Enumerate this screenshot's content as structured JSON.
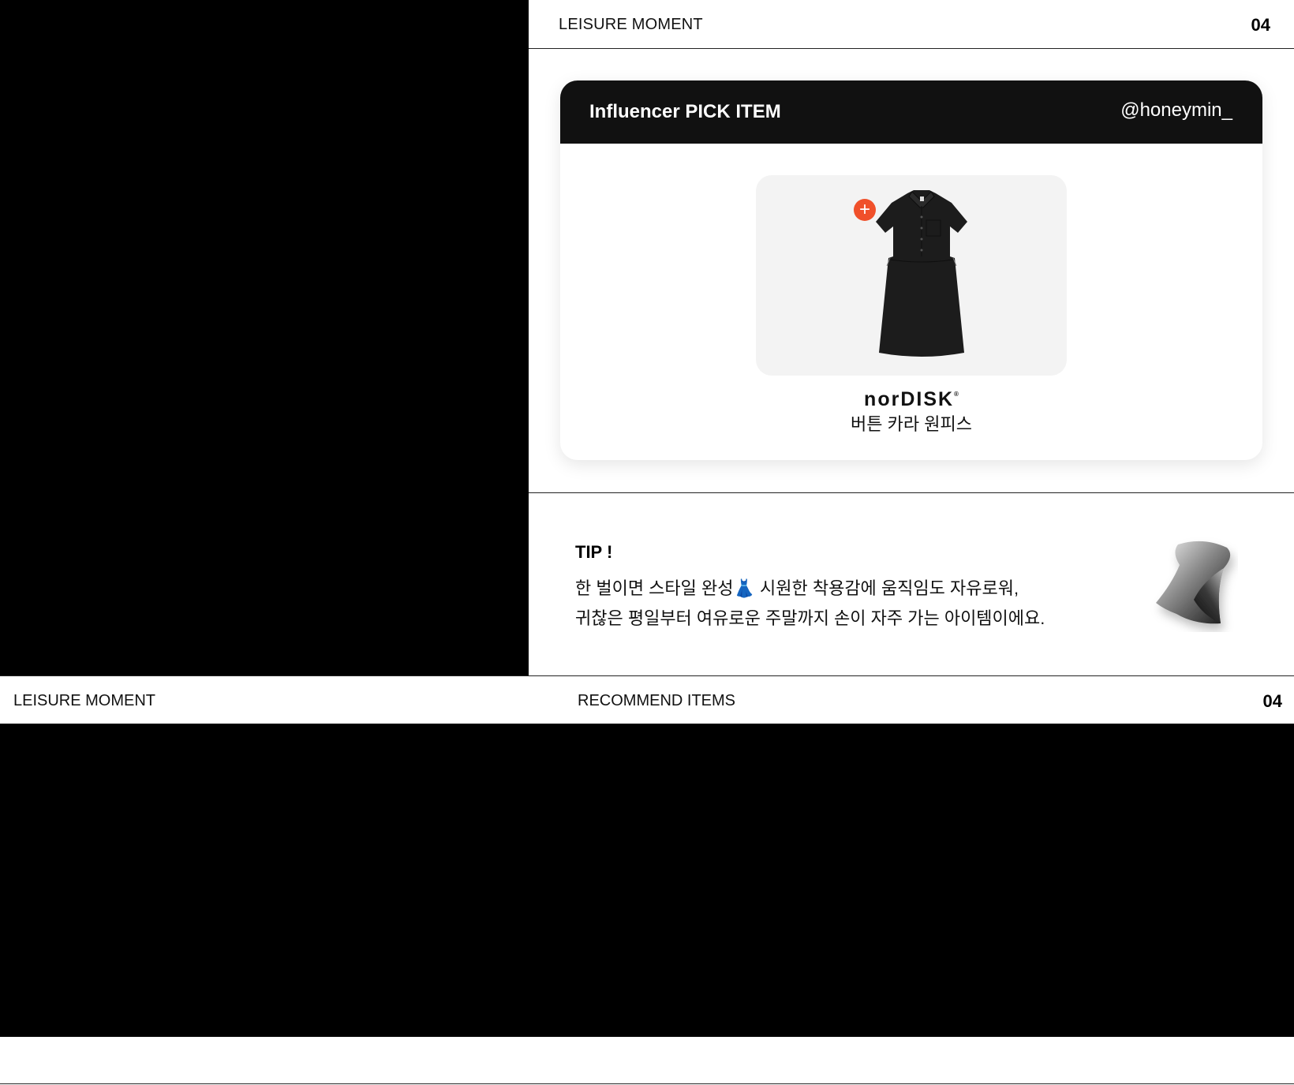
{
  "panel": {
    "header": {
      "title": "LEISURE MOMENT",
      "page_number": "04"
    },
    "card": {
      "title": "Influencer PICK ITEM",
      "handle": "@honeymin_",
      "product": {
        "brand": "norDISK",
        "brand_mark": "®",
        "name": "버튼 카라 원피스",
        "add_label": "+"
      }
    },
    "tip": {
      "title": "TIP !",
      "line1": "한 벌이면 스타일 완성👗 시원한 착용감에 움직임도 자유로워,",
      "line2": "귀찮은 평일부터 여유로운 주말까지 손이 자주 가는 아이템이에요."
    }
  },
  "strip": {
    "left_title": "LEISURE MOMENT",
    "center_title": "RECOMMEND ITEMS",
    "page_number": "04"
  },
  "colors": {
    "accent": "#f0502a",
    "card_header": "#111111",
    "product_bg": "#f3f3f3",
    "background": "#000000"
  }
}
